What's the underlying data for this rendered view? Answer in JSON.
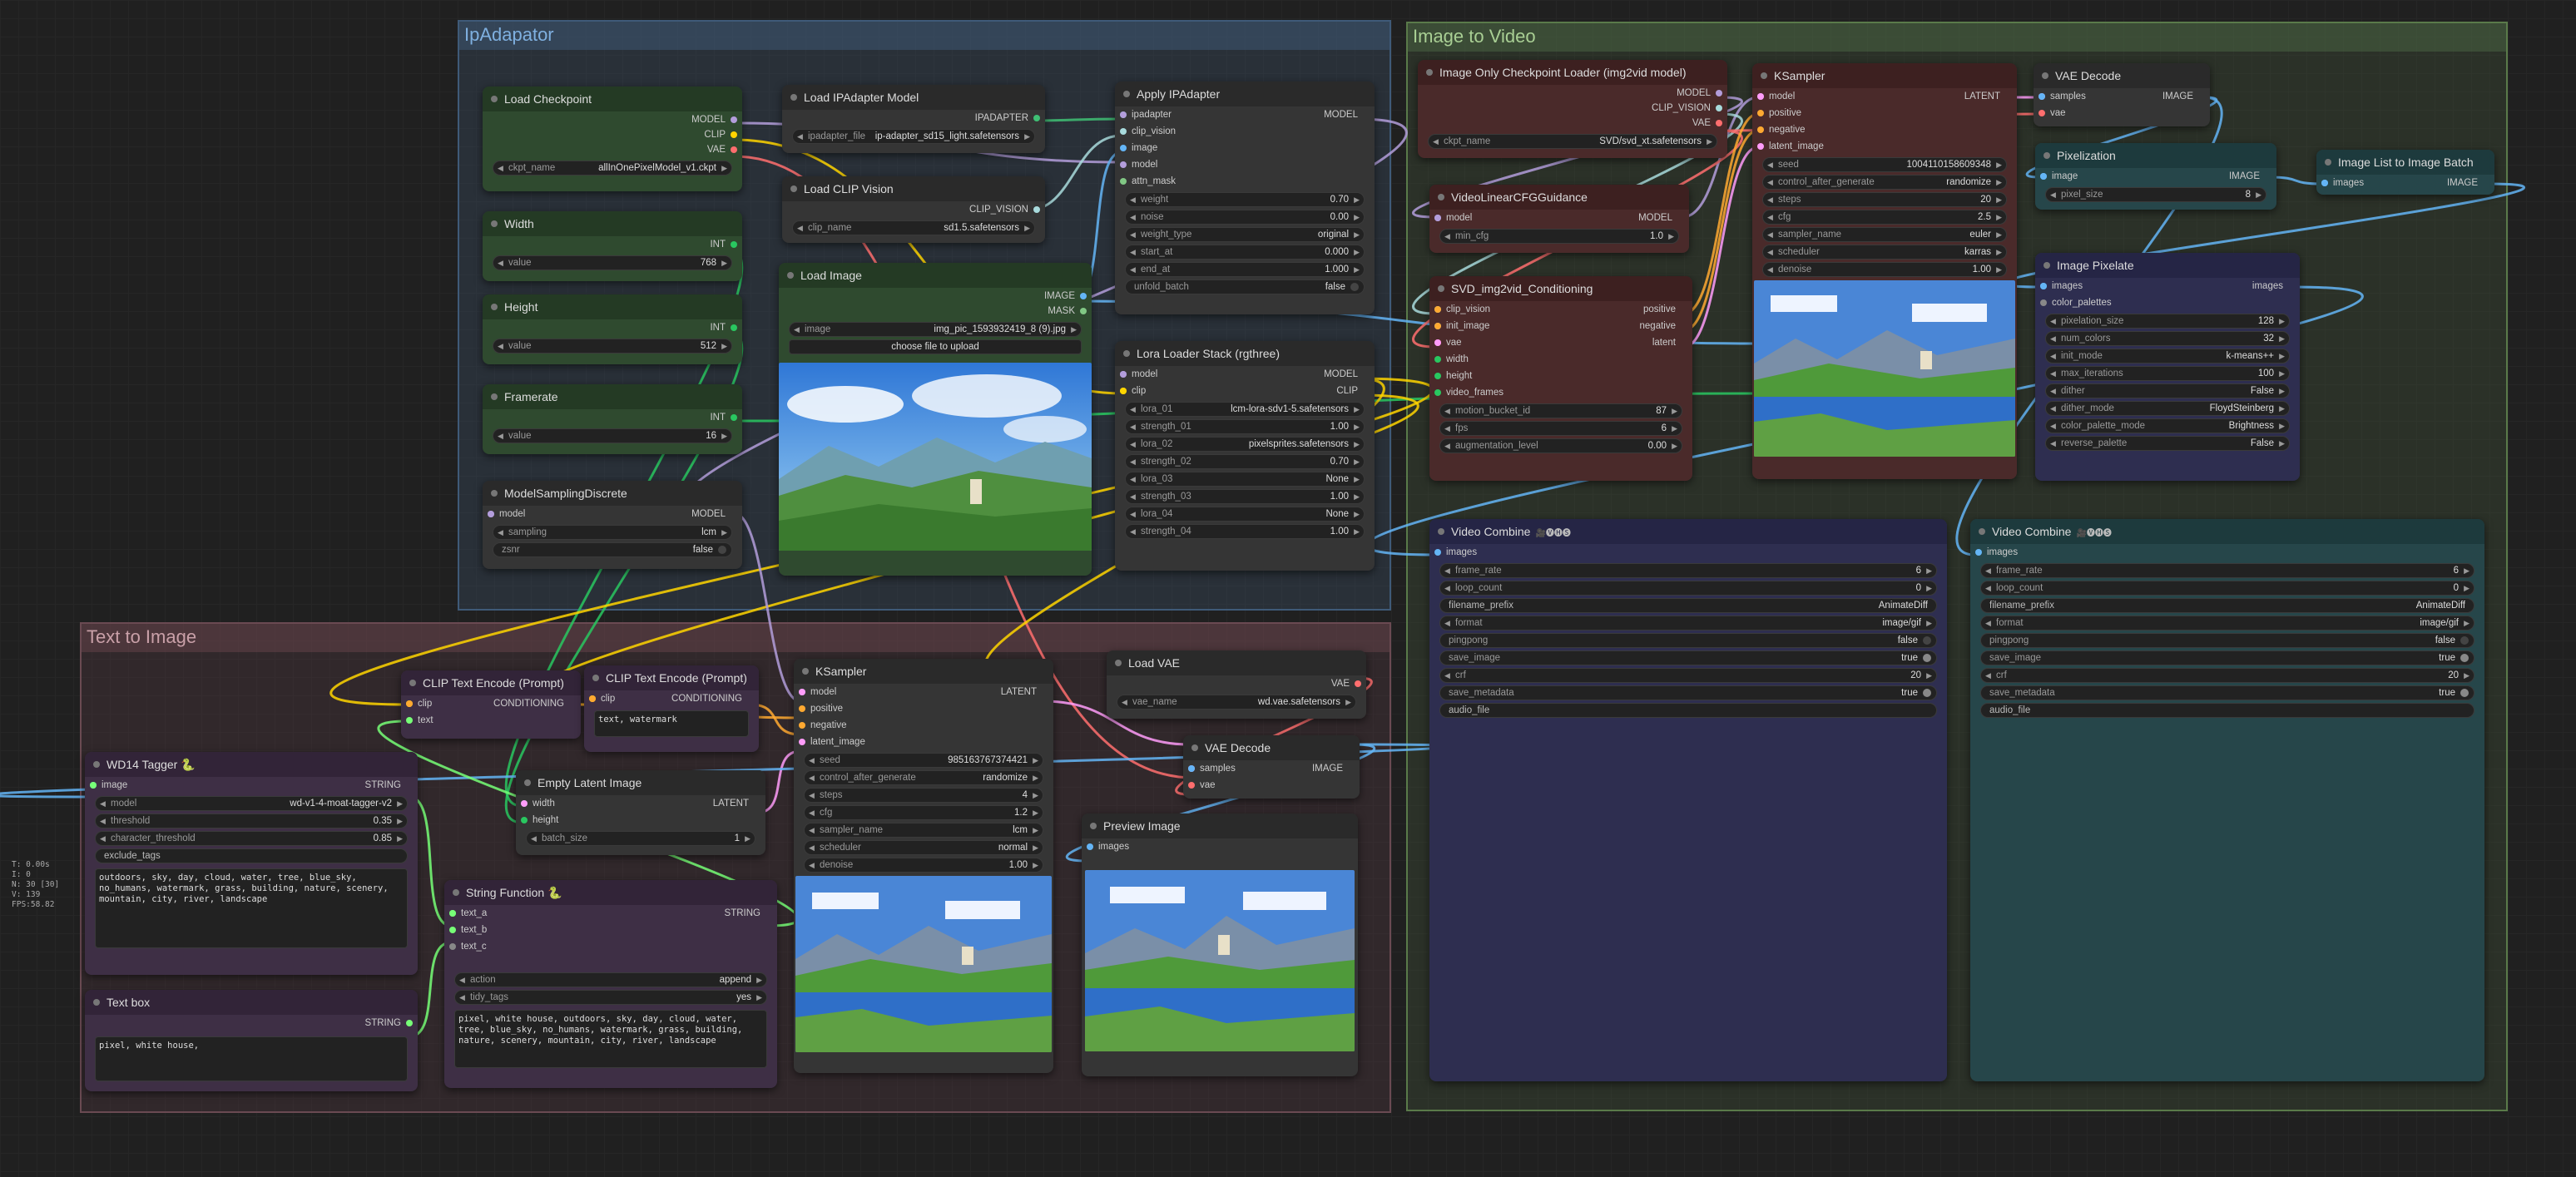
{
  "groups": {
    "ipadapter": "IpAdapator",
    "text_to_image": "Text to Image",
    "image_to_video": "Image to Video"
  },
  "load_checkpoint": {
    "title": "Load Checkpoint",
    "outputs": [
      "MODEL",
      "CLIP",
      "VAE"
    ],
    "ckpt_label": "ckpt_name",
    "ckpt_value": "allInOnePixelModel_v1.ckpt"
  },
  "width_node": {
    "title": "Width",
    "out": "INT",
    "label": "value",
    "value": "768"
  },
  "height_node": {
    "title": "Height",
    "out": "INT",
    "label": "value",
    "value": "512"
  },
  "framerate_node": {
    "title": "Framerate",
    "out": "INT",
    "label": "value",
    "value": "16"
  },
  "model_sampling": {
    "title": "ModelSamplingDiscrete",
    "in": "model",
    "out": "MODEL",
    "sampling_label": "sampling",
    "sampling_value": "lcm",
    "zsnr_label": "zsnr",
    "zsnr_value": "false"
  },
  "load_ipadapter": {
    "title": "Load IPAdapter Model",
    "out": "IPADAPTER",
    "label": "ipadapter_file",
    "value": "ip-adapter_sd15_light.safetensors"
  },
  "load_clip_vision": {
    "title": "Load CLIP Vision",
    "out": "CLIP_VISION",
    "label": "clip_name",
    "value": "sd1.5.safetensors"
  },
  "load_image": {
    "title": "Load Image",
    "outputs": [
      "IMAGE",
      "MASK"
    ],
    "label": "image",
    "value": "img_pic_1593932419_8 (9).jpg",
    "button": "choose file to upload"
  },
  "apply_ipadapter": {
    "title": "Apply IPAdapter",
    "inputs": [
      "ipadapter",
      "clip_vision",
      "image",
      "model",
      "attn_mask"
    ],
    "out": "MODEL",
    "widgets": [
      {
        "label": "weight",
        "value": "0.70"
      },
      {
        "label": "noise",
        "value": "0.00"
      },
      {
        "label": "weight_type",
        "value": "original"
      },
      {
        "label": "start_at",
        "value": "0.000"
      },
      {
        "label": "end_at",
        "value": "1.000"
      },
      {
        "label": "unfold_batch",
        "value": "false"
      }
    ]
  },
  "lora_stack": {
    "title": "Lora Loader Stack (rgthree)",
    "inputs": [
      "model",
      "clip"
    ],
    "outputs": [
      "MODEL",
      "CLIP"
    ],
    "widgets": [
      {
        "label": "lora_01",
        "value": "lcm-lora-sdv1-5.safetensors"
      },
      {
        "label": "strength_01",
        "value": "1.00"
      },
      {
        "label": "lora_02",
        "value": "pixelsprites.safetensors"
      },
      {
        "label": "strength_02",
        "value": "0.70"
      },
      {
        "label": "lora_03",
        "value": "None"
      },
      {
        "label": "strength_03",
        "value": "1.00"
      },
      {
        "label": "lora_04",
        "value": "None"
      },
      {
        "label": "strength_04",
        "value": "1.00"
      }
    ]
  },
  "wd14": {
    "title": "WD14 Tagger 🐍",
    "in": "image",
    "out": "STRING",
    "widgets": [
      {
        "label": "model",
        "value": "wd-v1-4-moat-tagger-v2"
      },
      {
        "label": "threshold",
        "value": "0.35"
      },
      {
        "label": "character_threshold",
        "value": "0.85"
      }
    ],
    "exclude": "exclude_tags",
    "text": "outdoors, sky, day, cloud, water, tree, blue_sky, no_humans, watermark, grass, building, nature, scenery, mountain, city, river, landscape"
  },
  "textbox": {
    "title": "Text box",
    "out": "STRING",
    "text": "pixel, white house,"
  },
  "clip_pos": {
    "title": "CLIP Text Encode (Prompt)",
    "inputs": [
      "clip",
      "text"
    ],
    "out": "CONDITIONING"
  },
  "clip_neg": {
    "title": "CLIP Text Encode (Prompt)",
    "in": "clip",
    "out": "CONDITIONING",
    "text": "text, watermark"
  },
  "empty_latent": {
    "title": "Empty Latent Image",
    "inputs": [
      "width",
      "height"
    ],
    "out": "LATENT",
    "label": "batch_size",
    "value": "1"
  },
  "string_fn": {
    "title": "String Function 🐍",
    "inputs": [
      "text_a",
      "text_b",
      "text_c"
    ],
    "out": "STRING",
    "widgets": [
      {
        "label": "action",
        "value": "append"
      },
      {
        "label": "tidy_tags",
        "value": "yes"
      }
    ],
    "text": "pixel, white house, outdoors, sky, day, cloud, water, tree, blue_sky, no_humans, watermark, grass, building, nature, scenery, mountain, city, river, landscape"
  },
  "ksampler1": {
    "title": "KSampler",
    "inputs": [
      "model",
      "positive",
      "negative",
      "latent_image"
    ],
    "out": "LATENT",
    "widgets": [
      {
        "label": "seed",
        "value": "985163767374421"
      },
      {
        "label": "control_after_generate",
        "value": "randomize"
      },
      {
        "label": "steps",
        "value": "4"
      },
      {
        "label": "cfg",
        "value": "1.2"
      },
      {
        "label": "sampler_name",
        "value": "lcm"
      },
      {
        "label": "scheduler",
        "value": "normal"
      },
      {
        "label": "denoise",
        "value": "1.00"
      }
    ]
  },
  "load_vae": {
    "title": "Load VAE",
    "out": "VAE",
    "label": "vae_name",
    "value": "wd.vae.safetensors"
  },
  "vae_decode1": {
    "title": "VAE Decode",
    "inputs": [
      "samples",
      "vae"
    ],
    "out": "IMAGE"
  },
  "preview": {
    "title": "Preview Image",
    "in": "images"
  },
  "img_only_ckpt": {
    "title": "Image Only Checkpoint Loader (img2vid model)",
    "outputs": [
      "MODEL",
      "CLIP_VISION",
      "VAE"
    ],
    "label": "ckpt_name",
    "value": "SVD/svd_xt.safetensors"
  },
  "linear_cfg": {
    "title": "VideoLinearCFGGuidance",
    "in": "model",
    "out": "MODEL",
    "label": "min_cfg",
    "value": "1.0"
  },
  "svd_cond": {
    "title": "SVD_img2vid_Conditioning",
    "inputs": [
      "clip_vision",
      "init_image",
      "vae",
      "width",
      "height",
      "video_frames"
    ],
    "outputs": [
      "positive",
      "negative",
      "latent"
    ],
    "widgets": [
      {
        "label": "motion_bucket_id",
        "value": "87"
      },
      {
        "label": "fps",
        "value": "6"
      },
      {
        "label": "augmentation_level",
        "value": "0.00"
      }
    ]
  },
  "ksampler2": {
    "title": "KSampler",
    "inputs": [
      "model",
      "positive",
      "negative",
      "latent_image"
    ],
    "out": "LATENT",
    "widgets": [
      {
        "label": "seed",
        "value": "1004110158609348"
      },
      {
        "label": "control_after_generate",
        "value": "randomize"
      },
      {
        "label": "steps",
        "value": "20"
      },
      {
        "label": "cfg",
        "value": "2.5"
      },
      {
        "label": "sampler_name",
        "value": "euler"
      },
      {
        "label": "scheduler",
        "value": "karras"
      },
      {
        "label": "denoise",
        "value": "1.00"
      }
    ]
  },
  "vae_decode2": {
    "title": "VAE Decode",
    "inputs": [
      "samples",
      "vae"
    ],
    "out": "IMAGE"
  },
  "pixelization": {
    "title": "Pixelization",
    "in": "image",
    "out": "IMAGE",
    "label": "pixel_size",
    "value": "8"
  },
  "img_list_batch": {
    "title": "Image List to Image Batch",
    "in": "images",
    "out": "IMAGE"
  },
  "image_pixelate": {
    "title": "Image Pixelate",
    "inputs": [
      "images",
      "color_palettes"
    ],
    "out": "images",
    "widgets": [
      {
        "label": "pixelation_size",
        "value": "128"
      },
      {
        "label": "num_colors",
        "value": "32"
      },
      {
        "label": "init_mode",
        "value": "k-means++"
      },
      {
        "label": "max_iterations",
        "value": "100"
      },
      {
        "label": "dither",
        "value": "False"
      },
      {
        "label": "dither_mode",
        "value": "FloydSteinberg"
      },
      {
        "label": "color_palette_mode",
        "value": "Brightness"
      },
      {
        "label": "reverse_palette",
        "value": "False"
      }
    ]
  },
  "video_combine1": {
    "title": "Video Combine",
    "badge": "🎥🅥🅗🅢",
    "in": "images",
    "widgets": [
      {
        "label": "frame_rate",
        "value": "6"
      },
      {
        "label": "loop_count",
        "value": "0"
      },
      {
        "label": "filename_prefix",
        "value": "AnimateDiff"
      },
      {
        "label": "format",
        "value": "image/gif"
      },
      {
        "label": "pingpong",
        "value": "false"
      },
      {
        "label": "save_image",
        "value": "true"
      },
      {
        "label": "crf",
        "value": "20"
      },
      {
        "label": "save_metadata",
        "value": "true"
      }
    ],
    "audio": "audio_file"
  },
  "video_combine2": {
    "title": "Video Combine",
    "badge": "🎥🅥🅗🅢",
    "in": "images",
    "widgets": [
      {
        "label": "frame_rate",
        "value": "6"
      },
      {
        "label": "loop_count",
        "value": "0"
      },
      {
        "label": "filename_prefix",
        "value": "AnimateDiff"
      },
      {
        "label": "format",
        "value": "image/gif"
      },
      {
        "label": "pingpong",
        "value": "false"
      },
      {
        "label": "save_image",
        "value": "true"
      },
      {
        "label": "crf",
        "value": "20"
      },
      {
        "label": "save_metadata",
        "value": "true"
      }
    ],
    "audio": "audio_file"
  },
  "stats": [
    "T: 0.00s",
    "I: 0",
    "N: 30 [30]",
    "V: 139",
    "FPS:58.82"
  ],
  "colors": {
    "model": "#b39ddb",
    "clip": "#ffd500",
    "vae": "#ff6e6e",
    "image": "#64b5f6",
    "latent": "#ff9cf9",
    "conditioning": "#ffa931",
    "int": "#29c760",
    "string": "#77ff77",
    "clip_vision": "#a8dadc",
    "ipadapter": "#3fbf74"
  }
}
